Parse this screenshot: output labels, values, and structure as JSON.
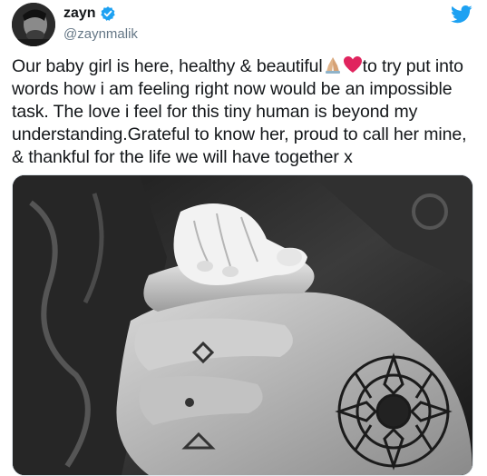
{
  "user": {
    "display_name": "zayn",
    "handle": "@zaynmalik",
    "verified": true,
    "avatar_icon": "profile-photo"
  },
  "brand": {
    "icon": "twitter-bird-icon",
    "color": "#1da1f2"
  },
  "tweet": {
    "text_part1": "Our baby girl is here, healthy & beautiful",
    "emoji1": "folded-hands",
    "emoji2": "red-heart",
    "text_part2": "to try put into words how i am feeling right now would be an impossible task. The love i feel for this tiny human is beyond my understanding.Grateful to know her, proud to call her mine, & thankful for the life we will have together x"
  },
  "media": {
    "type": "photo",
    "style": "black-and-white",
    "subject": "baby hand holding tattooed adult hand"
  },
  "colors": {
    "text": "#14171a",
    "secondary": "#657786",
    "verified": "#1da1f2",
    "heart": "#e0245e"
  }
}
